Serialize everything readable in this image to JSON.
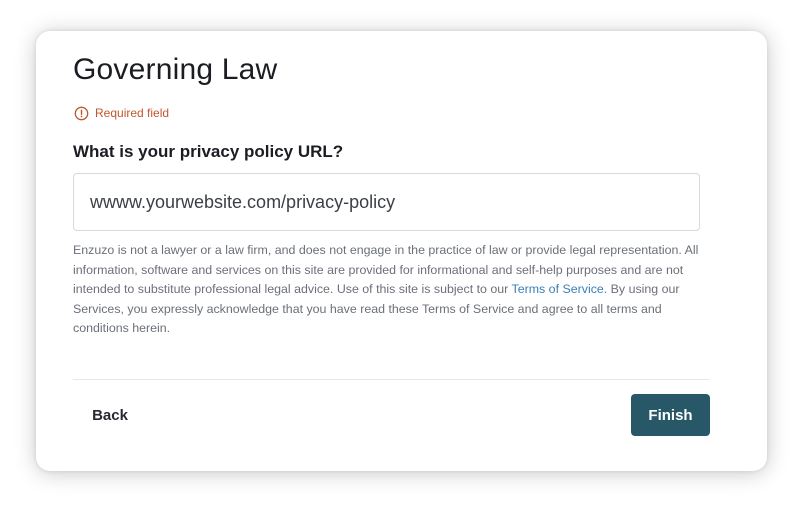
{
  "form": {
    "title": "Governing Law",
    "required_label": "Required field",
    "required_icon": "alert-circle-icon",
    "question": "What is your privacy policy URL?",
    "url_value": "wwww.yourwebsite.com/privacy-policy",
    "disclaimer_before_link": "Enzuzo is not a lawyer or a law firm, and does not engage in the practice of law or provide legal representation. All information, software and services on this site are provided for informational and self-help purposes and are not intended to substitute professional legal advice. Use of this site is subject to our ",
    "disclaimer_link": "Terms of Service",
    "disclaimer_after_link": ". By using our Services, you expressly acknowledge that you have read these Terms of Service and agree to all terms and conditions herein."
  },
  "actions": {
    "back_label": "Back",
    "finish_label": "Finish"
  },
  "colors": {
    "required": "#c2562f",
    "link": "#3a7fb8",
    "finish_bg": "#285767"
  }
}
